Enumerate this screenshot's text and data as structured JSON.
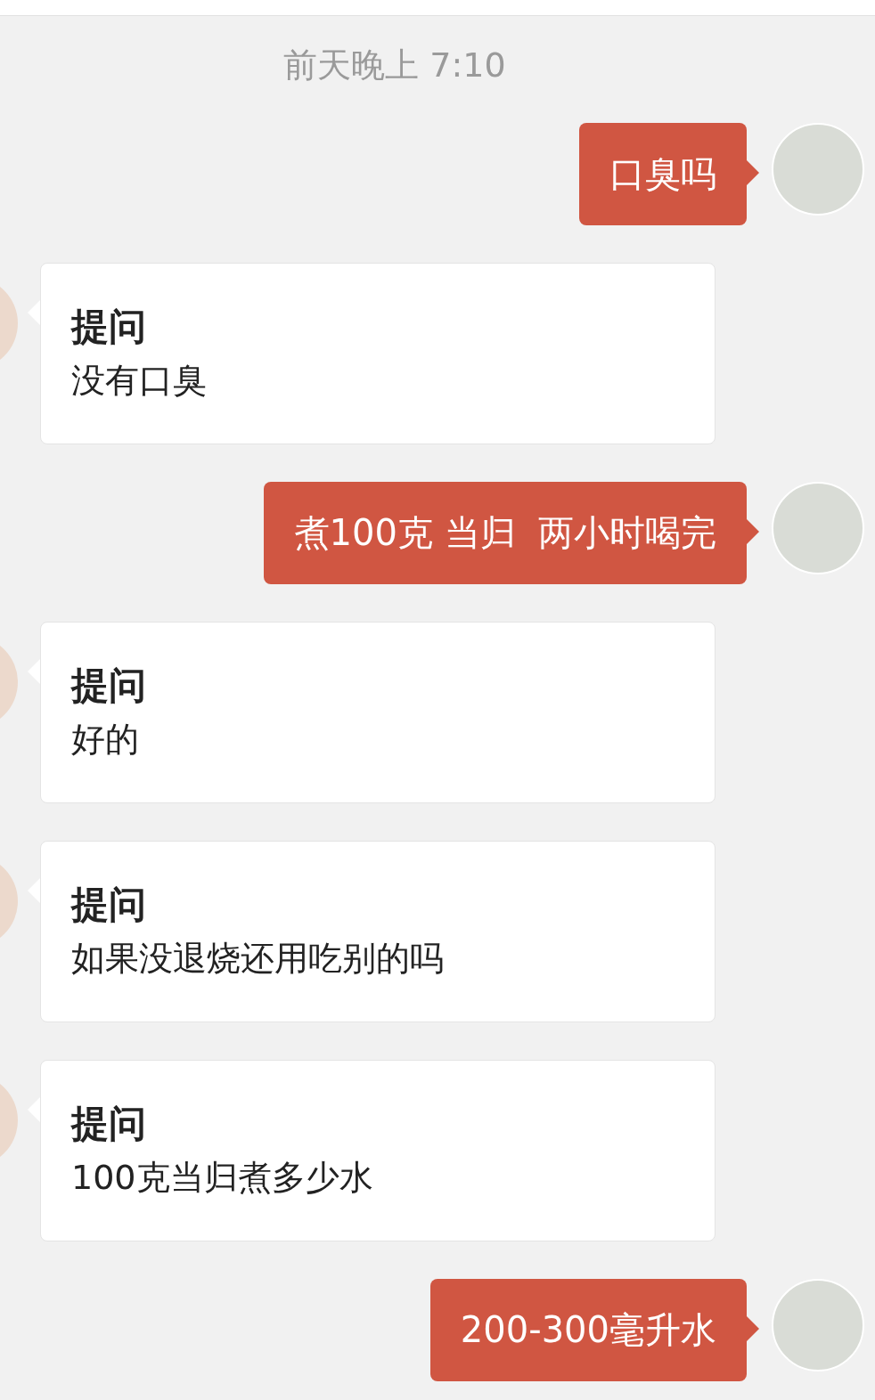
{
  "timestamp": "前天晚上 7:10",
  "messages": [
    {
      "kind": "sent",
      "text": "口臭吗"
    },
    {
      "kind": "received",
      "title": "提问",
      "text": "没有口臭"
    },
    {
      "kind": "sent",
      "text": "煮100克 当归  两小时喝完"
    },
    {
      "kind": "received",
      "title": "提问",
      "text": "好的"
    },
    {
      "kind": "received",
      "title": "提问",
      "text": "如果没退烧还用吃别的吗"
    },
    {
      "kind": "received",
      "title": "提问",
      "text": "100克当归煮多少水"
    },
    {
      "kind": "sent",
      "text": "200-300毫升水"
    }
  ]
}
